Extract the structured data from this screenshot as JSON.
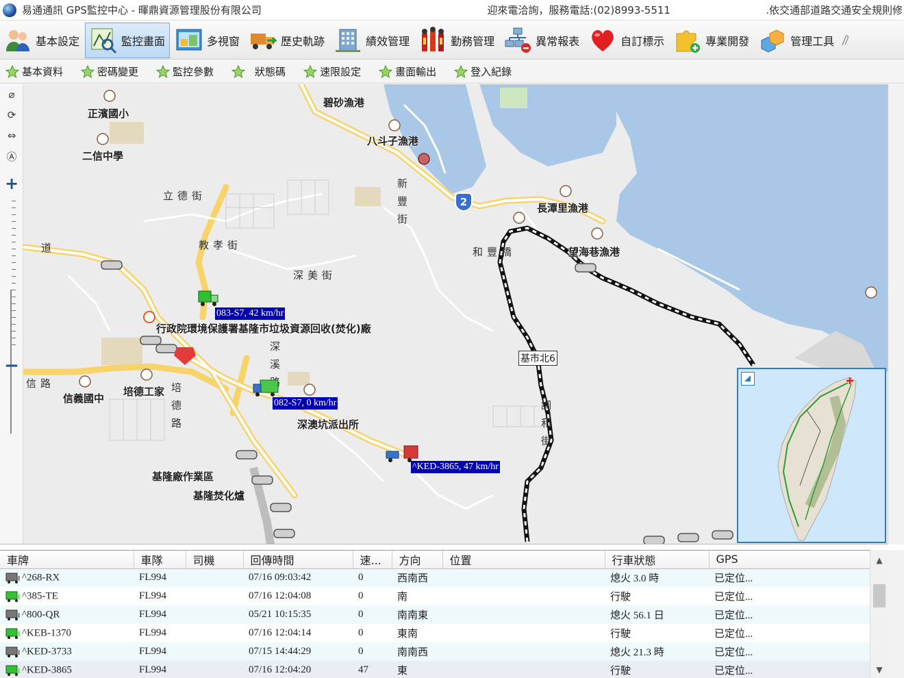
{
  "window": {
    "title": "易通通訊 GPS監控中心 - 暉鼎資源管理股份有限公司",
    "hotline": "迎來電洽詢，服務電話:(02)8993-5511",
    "notice": ".依交通部道路交通安全規則修"
  },
  "main_menu": [
    {
      "label": "基本設定",
      "icon": "users-icon"
    },
    {
      "label": "監控畫面",
      "icon": "map-monitor-icon"
    },
    {
      "label": "多視窗",
      "icon": "multi-window-icon"
    },
    {
      "label": "歷史軌跡",
      "icon": "truck-history-icon"
    },
    {
      "label": "績效管理",
      "icon": "building-icon"
    },
    {
      "label": "勤務管理",
      "icon": "people-duty-icon"
    },
    {
      "label": "異常報表",
      "icon": "network-alert-icon"
    },
    {
      "label": "自訂標示",
      "icon": "heart-icon"
    },
    {
      "label": "專業開發",
      "icon": "puzzle-icon"
    },
    {
      "label": "管理工具",
      "icon": "boxes-icon"
    }
  ],
  "sub_menu": [
    {
      "label": "基本資料"
    },
    {
      "label": "密碼變更"
    },
    {
      "label": "監控參數"
    },
    {
      "label": "狀態碼"
    },
    {
      "label": "速限設定"
    },
    {
      "label": "畫面輸出"
    },
    {
      "label": "登入紀錄"
    }
  ],
  "map": {
    "places": [
      {
        "text": "正濱國小"
      },
      {
        "text": "二信中學"
      },
      {
        "text": "碧砂漁港"
      },
      {
        "text": "八斗子漁港"
      },
      {
        "text": "長潭里漁港"
      },
      {
        "text": "望海巷漁港"
      },
      {
        "text": "行政院環境保護署基隆市垃圾資源回收(焚化)廠"
      },
      {
        "text": "信義國中"
      },
      {
        "text": "培德工家"
      },
      {
        "text": "深澳坑派出所"
      },
      {
        "text": "基隆廠作業區"
      },
      {
        "text": "基隆焚化爐"
      }
    ],
    "streets": [
      {
        "text": "立德街"
      },
      {
        "text": "教孝街"
      },
      {
        "text": "深美街"
      },
      {
        "text": "和豐橋"
      },
      {
        "text": "道"
      },
      {
        "text": "信路"
      }
    ],
    "vertical_streets": [
      {
        "text": "新豐街"
      },
      {
        "text": "深溪路"
      },
      {
        "text": "培德路"
      },
      {
        "text": "調和街"
      }
    ],
    "route_shield": "2",
    "road_sign": "基市北6",
    "vehicles": [
      {
        "label": "083-S7, 42 km/hr"
      },
      {
        "label": "082-S7, 0 km/hr"
      },
      {
        "label": "^KED-3865, 47 km/hr"
      }
    ],
    "colors": {
      "sea": "#a9c8e8",
      "land": "#ececec",
      "road": "#f7d36a",
      "label_bg": "#0000b0",
      "overview_border": "#2d7bc4"
    }
  },
  "grid": {
    "columns": [
      "車牌",
      "車隊",
      "司機",
      "回傳時間",
      "速...",
      "方向",
      "位置",
      "行車狀態",
      "GPS"
    ],
    "rows": [
      {
        "plate": "^268-RX",
        "fleet": "FL994",
        "driver": "",
        "time": "07/16 09:03:42",
        "speed": "0",
        "dir": "西南西",
        "loc": "",
        "status": "熄火 3.0 時",
        "gps": "已定位..."
      },
      {
        "plate": "^385-TE",
        "fleet": "FL994",
        "driver": "",
        "time": "07/16 12:04:08",
        "speed": "0",
        "dir": "南",
        "loc": "",
        "status": "行駛",
        "gps": "已定位..."
      },
      {
        "plate": "^800-QR",
        "fleet": "FL994",
        "driver": "",
        "time": "05/21 10:15:35",
        "speed": "0",
        "dir": "南南東",
        "loc": "",
        "status": "熄火 56.1 日",
        "gps": "已定位..."
      },
      {
        "plate": "^KEB-1370",
        "fleet": "FL994",
        "driver": "",
        "time": "07/16 12:04:14",
        "speed": "0",
        "dir": "東南",
        "loc": "",
        "status": "行駛",
        "gps": "已定位..."
      },
      {
        "plate": "^KED-3733",
        "fleet": "FL994",
        "driver": "",
        "time": "07/15 14:44:29",
        "speed": "0",
        "dir": "南南西",
        "loc": "",
        "status": "熄火 21.3 時",
        "gps": "已定位..."
      },
      {
        "plate": "^KED-3865",
        "fleet": "FL994",
        "driver": "",
        "time": "07/16 12:04:20",
        "speed": "47",
        "dir": "東",
        "loc": "",
        "status": "行駛",
        "gps": "已定位..."
      }
    ]
  }
}
